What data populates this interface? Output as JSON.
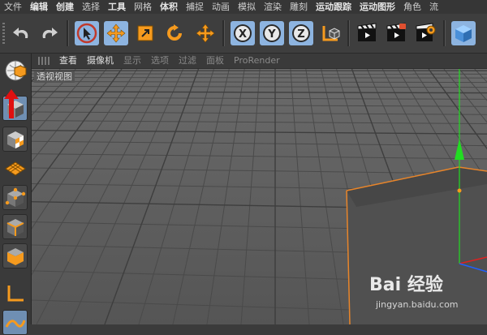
{
  "menubar": {
    "items": [
      {
        "label": "文件",
        "bold": false
      },
      {
        "label": "编辑",
        "bold": true
      },
      {
        "label": "创建",
        "bold": true
      },
      {
        "label": "选择",
        "bold": false
      },
      {
        "label": "工具",
        "bold": true
      },
      {
        "label": "网格",
        "bold": false
      },
      {
        "label": "体积",
        "bold": true
      },
      {
        "label": "捕捉",
        "bold": false
      },
      {
        "label": "动画",
        "bold": false
      },
      {
        "label": "模拟",
        "bold": false
      },
      {
        "label": "渲染",
        "bold": false
      },
      {
        "label": "雕刻",
        "bold": false
      },
      {
        "label": "运动跟踪",
        "bold": true
      },
      {
        "label": "运动图形",
        "bold": true
      },
      {
        "label": "角色",
        "bold": false
      },
      {
        "label": "流",
        "bold": false
      }
    ]
  },
  "toolbar": {
    "undo_icon": "undo-icon",
    "redo_icon": "redo-icon",
    "axis_x": "X",
    "axis_y": "Y",
    "axis_z": "Z"
  },
  "viewport_header": {
    "menus": [
      {
        "label": "查看",
        "enabled": true
      },
      {
        "label": "摄像机",
        "enabled": true
      },
      {
        "label": "显示",
        "enabled": false
      },
      {
        "label": "选项",
        "enabled": false
      },
      {
        "label": "过滤",
        "enabled": false
      },
      {
        "label": "面板",
        "enabled": false
      },
      {
        "label": "ProRender",
        "enabled": false
      }
    ]
  },
  "viewport": {
    "label": "透视视图"
  },
  "watermark": {
    "logo": "Bai 经验",
    "url": "jingyan.baidu.com"
  },
  "colors": {
    "accent_blue": "#8db4e0",
    "accent_orange": "#f59a1e",
    "axis_green": "#22dd22",
    "axis_red": "#e02020",
    "selection_orange": "#e8852a"
  }
}
